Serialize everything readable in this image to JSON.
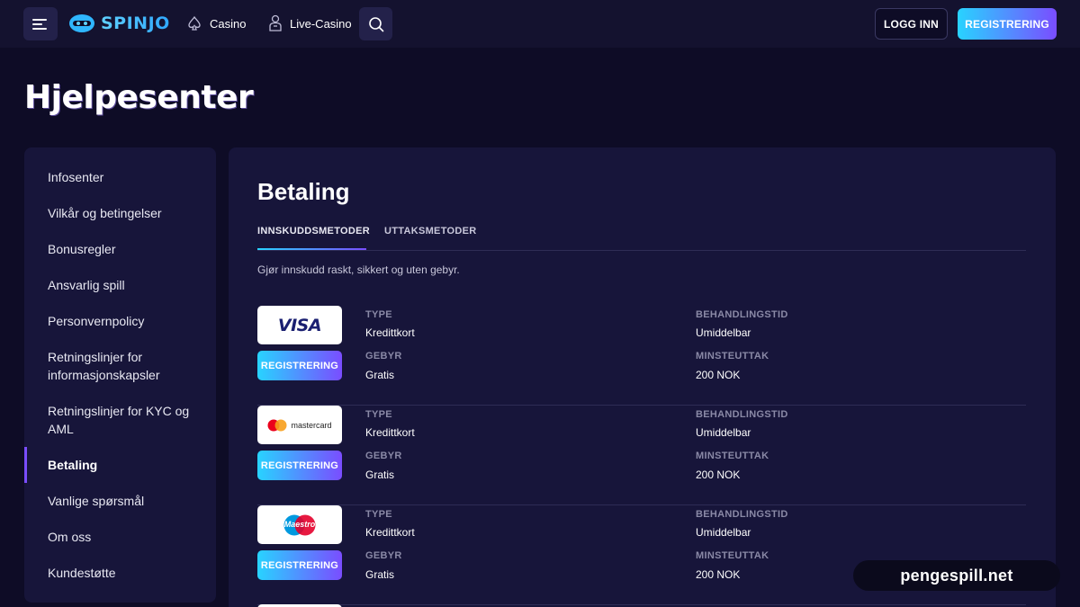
{
  "header": {
    "logo_text": "SPINJO",
    "nav": [
      {
        "label": "Casino",
        "icon": "spade-icon"
      },
      {
        "label": "Live-Casino",
        "icon": "dealer-icon"
      }
    ],
    "login_label": "LOGG INN",
    "register_label": "REGISTRERING"
  },
  "page": {
    "title": "Hjelpesenter"
  },
  "sidebar": {
    "items": [
      {
        "label": "Infosenter"
      },
      {
        "label": "Vilkår og betingelser"
      },
      {
        "label": "Bonusregler"
      },
      {
        "label": "Ansvarlig spill"
      },
      {
        "label": "Personvernpolicy"
      },
      {
        "label": "Retningslinjer for informasjonskapsler"
      },
      {
        "label": "Retningslinjer for KYC og AML"
      },
      {
        "label": "Betaling",
        "active": true
      },
      {
        "label": "Vanlige spørsmål"
      },
      {
        "label": "Om oss"
      },
      {
        "label": "Kundestøtte"
      }
    ]
  },
  "main": {
    "title": "Betaling",
    "tabs": [
      {
        "label": "INNSKUDDSMETODER",
        "active": true
      },
      {
        "label": "UTTAKSMETODER"
      }
    ],
    "intro": "Gjør innskudd raskt, sikkert og uten gebyr.",
    "labels": {
      "type": "TYPE",
      "fee": "GEBYR",
      "processing": "BEHANDLINGSTID",
      "min": "MINSTEUTTAK"
    },
    "methods": [
      {
        "logo": "VISA",
        "button": "REGISTRERING",
        "type": "Kredittkort",
        "fee": "Gratis",
        "processing": "Umiddelbar",
        "min": "200 NOK"
      },
      {
        "logo": "mastercard",
        "button": "REGISTRERING",
        "type": "Kredittkort",
        "fee": "Gratis",
        "processing": "Umiddelbar",
        "min": "200 NOK"
      },
      {
        "logo": "Maestro",
        "button": "REGISTRERING",
        "type": "Kredittkort",
        "fee": "Gratis",
        "processing": "Umiddelbar",
        "min": "200 NOK"
      }
    ]
  },
  "watermark": "pengespill.net",
  "colors": {
    "background": "#0e0c26",
    "panel": "#17153a",
    "accent_start": "#28d3ff",
    "accent_end": "#7a4dff"
  }
}
